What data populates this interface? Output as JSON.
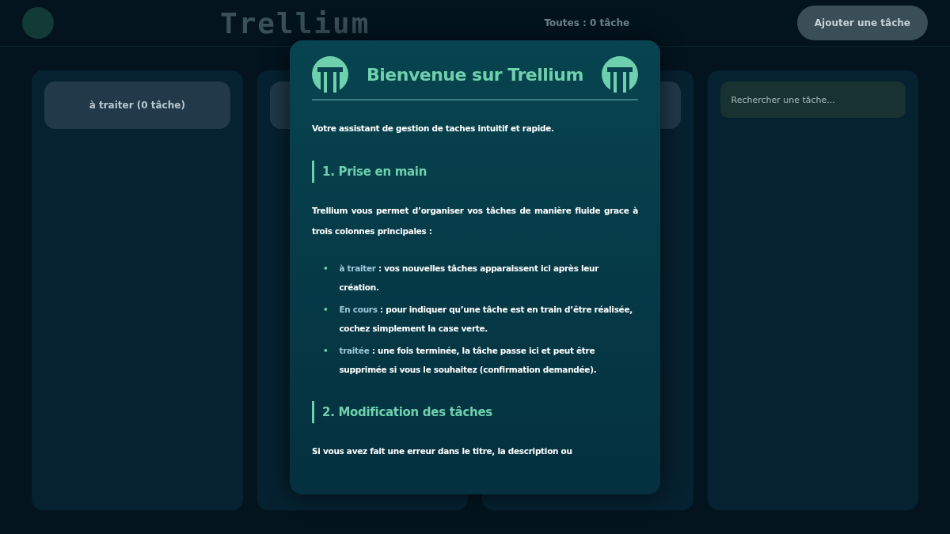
{
  "header": {
    "title": "Trellium",
    "counter": "Toutes : 0 tâche",
    "add_button": "Ajouter une tâche"
  },
  "columns": [
    {
      "kind": "header",
      "label": "à traiter (0 tâche)"
    },
    {
      "kind": "header"
    },
    {
      "kind": "header"
    },
    {
      "kind": "search",
      "placeholder": "Rechercher une tâche..."
    }
  ],
  "modal": {
    "title": "Bienvenue sur Trellium",
    "intro": "Votre assistant de gestion de taches intuitif et rapide.",
    "sections": [
      {
        "heading": "1. Prise en main",
        "paragraph": "Trellium vous permet d’organiser vos tâches de manière fluide grace à trois colonnes principales :",
        "items": [
          {
            "bullet": "•",
            "term": "à traiter",
            "text": " : vos nouvelles tâches apparaissent ici après leur création."
          },
          {
            "bullet": "•",
            "term": "En cours",
            "text": " : pour indiquer qu’une tâche est en train d’être réalisée, cochez simplement la case verte."
          },
          {
            "bullet": "•",
            "term": "traitée",
            "text": " : une fois terminée, la tâche passe ici et peut être supprimée si vous le souhaitez (confirmation demandée)."
          }
        ]
      },
      {
        "heading": "2. Modification des tâches",
        "paragraph": "Si vous avez fait une erreur dans le titre, la description ou"
      }
    ]
  }
}
